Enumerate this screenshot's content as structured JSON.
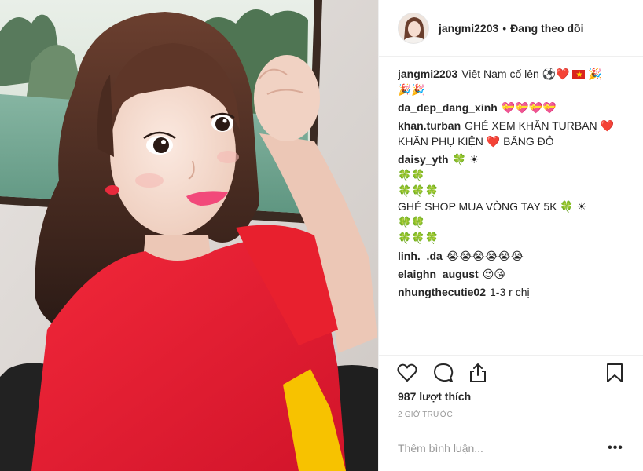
{
  "post": {
    "username": "jangmi2203",
    "separator": "•",
    "follow_status": "Đang theo dõi"
  },
  "comments": [
    {
      "user": "jangmi2203",
      "lines": [
        "Việt Nam cố lên ⚽️❤️",
        "🎉",
        "🎉🎉"
      ]
    },
    {
      "user": "da_dep_dang_xinh",
      "lines": [
        "💝💝💝💝"
      ]
    },
    {
      "user": "khan.turban",
      "lines": [
        "GHÉ XEM KHĂN TURBAN ❤️",
        "KHĂN PHỤ KIỆN ❤️ BĂNG ĐÔ"
      ]
    },
    {
      "user": "daisy_yth",
      "lines": [
        "🍀 ☀",
        "🍀🍀",
        "🍀🍀🍀",
        "GHÉ SHOP MUA VÒNG TAY 5K 🍀 ☀",
        "🍀🍀",
        "🍀🍀🍀"
      ]
    },
    {
      "user": "linh._.da",
      "lines": [
        "😭😭😭😭😭😭"
      ]
    },
    {
      "user": "elaighn_august",
      "lines": [
        "😍😘"
      ]
    },
    {
      "user": "nhungthecutie02",
      "lines": [
        "1-3 r chị"
      ]
    }
  ],
  "actions": {
    "like_icon": "heart-outline-icon",
    "comment_icon": "speech-bubble-icon",
    "share_icon": "share-upload-icon",
    "save_icon": "bookmark-icon"
  },
  "likes_text": "987 lượt thích",
  "time_ago": "2 GIỜ TRƯỚC",
  "add_comment": {
    "placeholder": "Thêm bình luận..."
  },
  "more_label": "•••",
  "colors": {
    "text": "#262626",
    "muted": "#999999",
    "divider": "#efefef",
    "shirt": "#e8202e"
  }
}
